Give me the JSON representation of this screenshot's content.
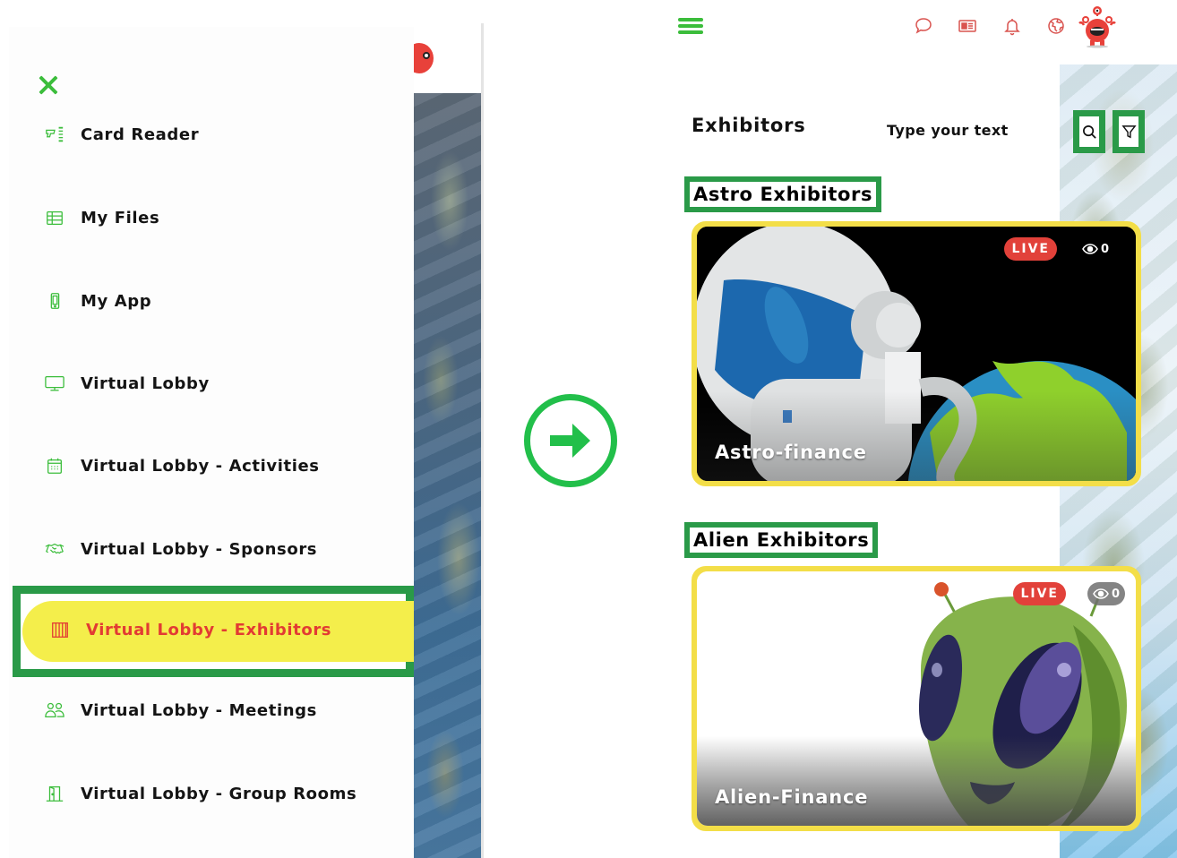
{
  "left_panel": {
    "menu": {
      "items": [
        {
          "label": "Card Reader",
          "icon": "card-reader-icon"
        },
        {
          "label": "My Files",
          "icon": "table-icon"
        },
        {
          "label": "My App",
          "icon": "mobile-phone-icon"
        },
        {
          "label": "Virtual Lobby",
          "icon": "monitor-icon"
        },
        {
          "label": "Virtual Lobby - Activities",
          "icon": "calendar-icon"
        },
        {
          "label": "Virtual Lobby - Sponsors",
          "icon": "handshake-icon"
        },
        {
          "label": "Virtual Lobby - Exhibitors",
          "icon": "booth-icon",
          "active": true
        },
        {
          "label": "Virtual Lobby - Meetings",
          "icon": "users-icon"
        },
        {
          "label": "Virtual Lobby - Group Rooms",
          "icon": "door-icon"
        }
      ]
    },
    "close_icon": "close-icon"
  },
  "transition_icon": "arrow-right-circle-icon",
  "right_panel": {
    "header": {
      "menu_icon": "hamburger-icon",
      "icons": [
        "chat-icon",
        "news-icon",
        "bell-icon",
        "globe-icon"
      ],
      "avatar": "monster-avatar"
    },
    "page_title": "Exhibitors",
    "search": {
      "placeholder": "Type your text"
    },
    "sections": [
      {
        "heading": "Astro Exhibitors",
        "card": {
          "title": "Astro-finance",
          "live_label": "LIVE",
          "viewers": "0"
        }
      },
      {
        "heading": "Alien Exhibitors",
        "card": {
          "title": "Alien-Finance",
          "live_label": "LIVE",
          "viewers": "0"
        }
      }
    ]
  },
  "colors": {
    "accent_green": "#3bbd3b",
    "highlight_green": "#2a9a48",
    "active_yellow": "#f4ee4b",
    "active_red": "#e23b33",
    "card_border_yellow": "#f3de48",
    "live_red": "#e2413a",
    "header_icon_red": "#d9534f"
  }
}
